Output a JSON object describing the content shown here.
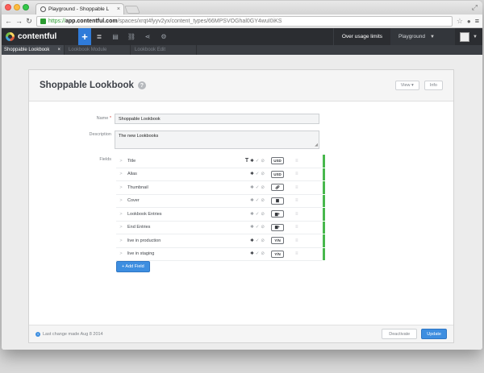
{
  "browser": {
    "tab_title": "Playground - Shoppable L",
    "tab_close": "×",
    "url_https": "https://",
    "url_host": "app.contentful.com",
    "url_path": "/spaces/xrqt4fyyv2yx/content_types/66MPSVOGhal0GY4wuI0iKS"
  },
  "app": {
    "logo_text": "contentful",
    "plus": "+",
    "usage_text": "Over usage limits",
    "space_name": "Playground",
    "tabs": [
      {
        "label": "Shoppable Lookbook",
        "close": "×"
      },
      {
        "label": "Lookbook Module"
      },
      {
        "label": "Lookbook Edit"
      }
    ]
  },
  "panel": {
    "title": "Shoppable Lookbook",
    "help": "?",
    "view_label": "View ▾",
    "info_label": "Info",
    "name_label": "Name",
    "required_mark": "*",
    "name_value": "Shoppable Lookbook",
    "description_label": "Description",
    "description_value": "The new Lookbooks",
    "fields_label": "Fields",
    "add_field_label": "+ Add Field",
    "footer_text": "Last change made Aug 8 2014",
    "deactivate_label": "Deactivate",
    "update_label": "Update"
  },
  "fields": [
    {
      "name": "Title",
      "type": "USD",
      "title_flag": "T",
      "required": true,
      "localized": false,
      "disabled": false
    },
    {
      "name": "Alias",
      "type": "USD",
      "title_flag": "",
      "required": true,
      "localized": false,
      "disabled": false
    },
    {
      "name": "Thumbnail",
      "type": "link-icon",
      "title_flag": "",
      "required": false,
      "localized": false,
      "disabled": false
    },
    {
      "name": "Cover",
      "type": "doc-icon",
      "title_flag": "",
      "required": false,
      "localized": false,
      "disabled": false
    },
    {
      "name": "Lookbook Entries",
      "type": "entries-icon",
      "title_flag": "",
      "required": false,
      "localized": false,
      "disabled": false
    },
    {
      "name": "End Entries",
      "type": "entries-icon",
      "title_flag": "",
      "required": false,
      "localized": false,
      "disabled": false
    },
    {
      "name": "live in production",
      "type": "Y/N",
      "title_flag": "",
      "required": true,
      "localized": false,
      "disabled": false
    },
    {
      "name": "live in staging",
      "type": "Y/N",
      "title_flag": "",
      "required": true,
      "localized": false,
      "disabled": false
    }
  ],
  "colors": {
    "primary": "#3d8ee0",
    "field_active_bar": "#48b84d",
    "appbar": "#2b2d31"
  }
}
